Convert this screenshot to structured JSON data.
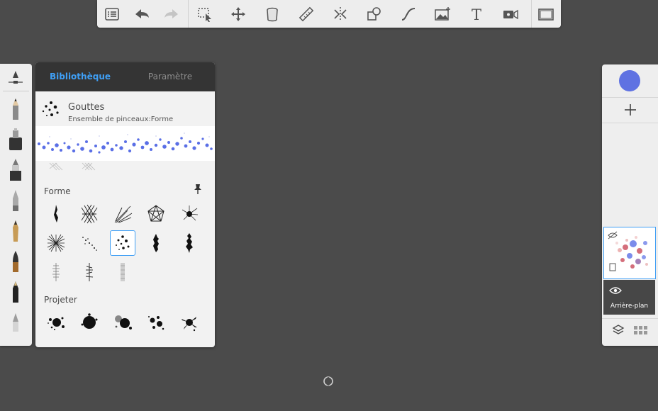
{
  "toolbar": {
    "items": [
      "list-icon",
      "undo-icon",
      "redo-icon",
      "select-icon",
      "move-icon",
      "fill-icon",
      "ruler-icon",
      "symmetry-icon",
      "shapes-icon",
      "curve-icon",
      "image-icon",
      "text-icon",
      "video-icon",
      "fullscreen-icon"
    ]
  },
  "panel": {
    "tab_library": "Bibliothèque",
    "tab_settings": "Paramètre",
    "brush_name": "Gouttes",
    "brush_set": "Ensemble de pinceaux:Forme",
    "section_forme": "Forme",
    "section_projeter": "Projeter"
  },
  "layers": {
    "background_label": "Arrière-plan",
    "current_color": "#5f72e2"
  },
  "colors": {
    "accent": "#3f9ff5",
    "tab_bg": "#343434",
    "canvas": "#4b4b4b"
  }
}
